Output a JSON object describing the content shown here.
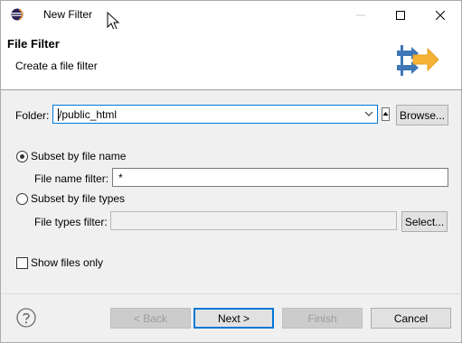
{
  "window": {
    "title": "New Filter"
  },
  "header": {
    "title": "File Filter",
    "description": "Create a file filter"
  },
  "folder": {
    "label": "Folder:",
    "value": "/public_html",
    "browse_label": "Browse..."
  },
  "subset_name": {
    "label": "Subset by file name",
    "selected": true,
    "filter_label": "File name filter:",
    "filter_value": "*"
  },
  "subset_types": {
    "label": "Subset by file types",
    "selected": false,
    "filter_label": "File types filter:",
    "filter_value": "",
    "select_label": "Select..."
  },
  "show_files": {
    "label": "Show files only",
    "checked": false
  },
  "footer": {
    "back_label": "< Back",
    "next_label": "Next >",
    "finish_label": "Finish",
    "cancel_label": "Cancel"
  },
  "colors": {
    "accent": "#0078d7",
    "banner_blue": "#3d77b5",
    "banner_orange": "#f5b335"
  },
  "icons": [
    "eclipse-app-icon",
    "mouse-cursor-icon",
    "minimize-icon",
    "maximize-icon",
    "close-icon",
    "wizard-banner-icon",
    "dropdown-arrow-icon",
    "help-icon"
  ]
}
